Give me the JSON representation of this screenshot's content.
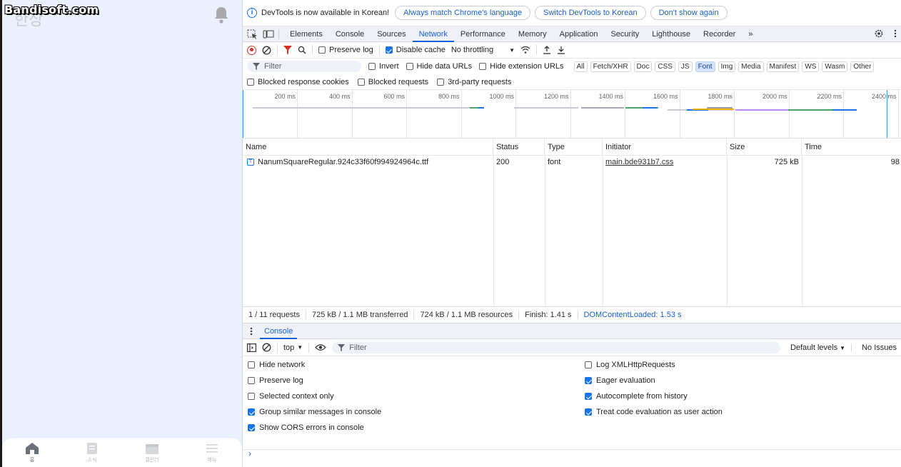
{
  "app": {
    "watermark": "Bandisoft.com",
    "ghost_title": "한상",
    "nav": [
      {
        "label": "홈",
        "icon": "home-icon",
        "active": true
      },
      {
        "label": "소식",
        "icon": "news-icon",
        "active": false
      },
      {
        "label": "캘린더",
        "icon": "calendar-icon",
        "active": false
      },
      {
        "label": "메뉴",
        "icon": "menu-icon",
        "active": false
      }
    ]
  },
  "infobar": {
    "message": "DevTools is now available in Korean!",
    "btn_match": "Always match Chrome's language",
    "btn_switch": "Switch DevTools to Korean",
    "btn_dont": "Don't show again"
  },
  "tabs": [
    "Elements",
    "Console",
    "Sources",
    "Network",
    "Performance",
    "Memory",
    "Application",
    "Security",
    "Lighthouse",
    "Recorder"
  ],
  "active_tab": "Network",
  "toolbar": {
    "preserve_log": "Preserve log",
    "disable_cache": "Disable cache",
    "throttling": "No throttling"
  },
  "filter": {
    "placeholder": "Filter",
    "invert": "Invert",
    "hide_data_urls": "Hide data URLs",
    "hide_ext_urls": "Hide extension URLs",
    "types": [
      "All",
      "Fetch/XHR",
      "Doc",
      "CSS",
      "JS",
      "Font",
      "Img",
      "Media",
      "Manifest",
      "WS",
      "Wasm",
      "Other"
    ],
    "active_type": "Font",
    "blocked_cookies": "Blocked response cookies",
    "blocked_requests": "Blocked requests",
    "third_party": "3rd-party requests"
  },
  "timeline": {
    "ticks": [
      "200 ms",
      "400 ms",
      "600 ms",
      "800 ms",
      "1000 ms",
      "1200 ms",
      "1400 ms",
      "1600 ms",
      "1800 ms",
      "2000 ms",
      "2200 ms",
      "2400 ms"
    ]
  },
  "table": {
    "columns": [
      "Name",
      "Status",
      "Type",
      "Initiator",
      "Size",
      "Time"
    ],
    "rows": [
      {
        "name": "NanumSquareRegular.924c33f60f994924964c.ttf",
        "status": "200",
        "type": "font",
        "initiator": "main.bde931b7.css",
        "size": "725 kB",
        "time": "98"
      }
    ]
  },
  "status": {
    "requests": "1 / 11 requests",
    "transferred": "725 kB / 1.1 MB transferred",
    "resources": "724 kB / 1.1 MB resources",
    "finish": "Finish: 1.41 s",
    "dcl": "DOMContentLoaded: 1.53 s"
  },
  "drawer": {
    "tab": "Console",
    "context": "top",
    "filter_placeholder": "Filter",
    "levels": "Default levels",
    "issues": "No Issues",
    "settings_left": [
      {
        "label": "Hide network",
        "checked": false
      },
      {
        "label": "Preserve log",
        "checked": false
      },
      {
        "label": "Selected context only",
        "checked": false
      },
      {
        "label": "Group similar messages in console",
        "checked": true
      },
      {
        "label": "Show CORS errors in console",
        "checked": true
      }
    ],
    "settings_right": [
      {
        "label": "Log XMLHttpRequests",
        "checked": false
      },
      {
        "label": "Eager evaluation",
        "checked": true
      },
      {
        "label": "Autocomplete from history",
        "checked": true
      },
      {
        "label": "Treat code evaluation as user action",
        "checked": true
      }
    ]
  }
}
